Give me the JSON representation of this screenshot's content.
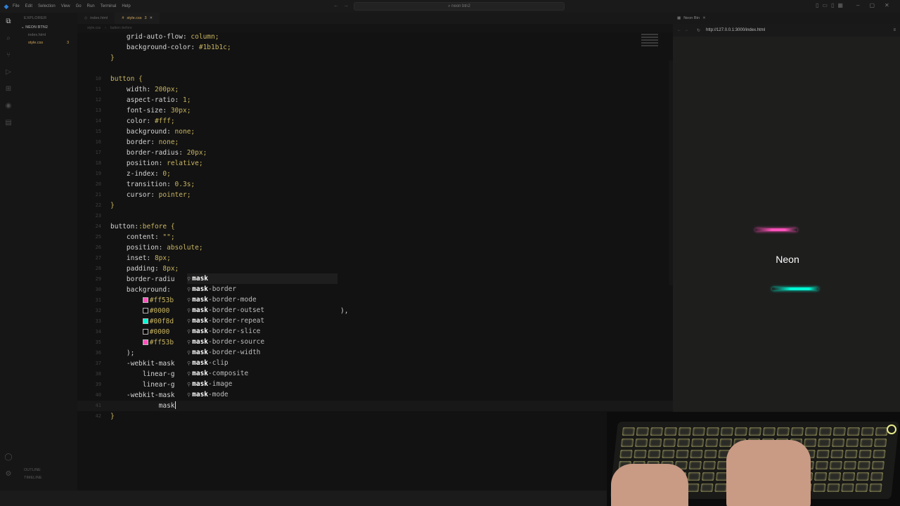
{
  "titlebar": {
    "menu": [
      "File",
      "Edit",
      "Selection",
      "View",
      "Go",
      "Run",
      "Terminal",
      "Help"
    ],
    "search": "neon btn2"
  },
  "sidebar": {
    "header": "EXPLORER",
    "folder": "NEON BTN2",
    "files": [
      {
        "name": "index.html",
        "type": "html"
      },
      {
        "name": "style.css",
        "type": "css",
        "badge": "3"
      }
    ],
    "outline": "OUTLINE",
    "timeline": "TIMELINE"
  },
  "tabs": [
    {
      "label": "index.html",
      "active": false
    },
    {
      "label": "style.css",
      "badge": "3",
      "active": true
    }
  ],
  "breadcrumb": [
    "style.css",
    "button::before"
  ],
  "editor": {
    "lines": [
      {
        "n": "",
        "text": "    grid-auto-flow: column;"
      },
      {
        "n": "",
        "text": "    background-color: #1b1b1c;"
      },
      {
        "n": "",
        "text": "}"
      },
      {
        "n": "",
        "text": ""
      },
      {
        "n": "10",
        "text": "button {"
      },
      {
        "n": "11",
        "text": "    width: 200px;"
      },
      {
        "n": "12",
        "text": "    aspect-ratio: 1;"
      },
      {
        "n": "13",
        "text": "    font-size: 30px;"
      },
      {
        "n": "14",
        "text": "    color: #fff;"
      },
      {
        "n": "15",
        "text": "    background: none;"
      },
      {
        "n": "16",
        "text": "    border: none;"
      },
      {
        "n": "17",
        "text": "    border-radius: 20px;"
      },
      {
        "n": "18",
        "text": "    position: relative;"
      },
      {
        "n": "19",
        "text": "    z-index: 0;"
      },
      {
        "n": "20",
        "text": "    transition: 0.3s;"
      },
      {
        "n": "21",
        "text": "    cursor: pointer;"
      },
      {
        "n": "22",
        "text": "}"
      },
      {
        "n": "23",
        "text": ""
      },
      {
        "n": "24",
        "text": "button::before {"
      },
      {
        "n": "25",
        "text": "    content: \"\";"
      },
      {
        "n": "26",
        "text": "    position: absolute;"
      },
      {
        "n": "27",
        "text": "    inset: 8px;"
      },
      {
        "n": "28",
        "text": "    padding: 8px;"
      },
      {
        "n": "29",
        "text": "    border-radiu"
      },
      {
        "n": "30",
        "text": "    background: "
      },
      {
        "n": "31",
        "text": "        #ff53b"
      },
      {
        "n": "32",
        "text": "        #0000"
      },
      {
        "n": "33",
        "text": "        #00f8d"
      },
      {
        "n": "34",
        "text": "        #0000"
      },
      {
        "n": "35",
        "text": "        #ff53b"
      },
      {
        "n": "36",
        "text": "    );"
      },
      {
        "n": "37",
        "text": "    -webkit-mask"
      },
      {
        "n": "38",
        "text": "        linear-g"
      },
      {
        "n": "39",
        "text": "        linear-g"
      },
      {
        "n": "40",
        "text": "    -webkit-mask"
      },
      {
        "n": "41",
        "text": "            mask"
      },
      {
        "n": "42",
        "text": "}"
      }
    ],
    "tail_30": "),",
    "suggestions": [
      "mask",
      "mask-border",
      "mask-border-mode",
      "mask-border-outset",
      "mask-border-repeat",
      "mask-border-slice",
      "mask-border-source",
      "mask-border-width",
      "mask-clip",
      "mask-composite",
      "mask-image",
      "mask-mode"
    ],
    "suggestion_prefix": "mask"
  },
  "preview": {
    "tab_title": "Neon Btn",
    "url": "http://127.0.0.1:3000/index.html",
    "button_label": "Neon"
  },
  "colors": {
    "pink": "#ff53bb",
    "teal": "#00f8d5",
    "bg": "#1b1b1c",
    "white": "#ffffff"
  }
}
